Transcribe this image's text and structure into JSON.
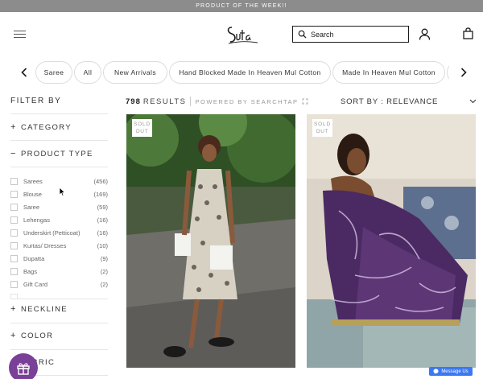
{
  "announcement": "PRODUCT OF THE WEEK!!",
  "header": {
    "logo_text": "Suta",
    "search_placeholder": "Search"
  },
  "categories": [
    "Saree",
    "All",
    "New Arrivals",
    "Hand Blocked Made In Heaven Mul Cotton",
    "Made In Heaven Mul Cotton"
  ],
  "sidebar": {
    "title": "FILTER BY",
    "facets": {
      "category": "CATEGORY",
      "product_type": "PRODUCT TYPE",
      "neckline": "NECKLINE",
      "color": "COLOR",
      "fabric": "FABRIC"
    },
    "product_types": [
      {
        "label": "Sarees",
        "count": "(456)"
      },
      {
        "label": "Blouse",
        "count": "(169)"
      },
      {
        "label": "Saree",
        "count": "(59)"
      },
      {
        "label": "Lehengas",
        "count": "(16)"
      },
      {
        "label": "Underskirt (Petticoat)",
        "count": "(16)"
      },
      {
        "label": "Kurtas/ Dresses",
        "count": "(10)"
      },
      {
        "label": "Dupatta",
        "count": "(9)"
      },
      {
        "label": "Bags",
        "count": "(2)"
      },
      {
        "label": "Gift Card",
        "count": "(2)"
      }
    ]
  },
  "results": {
    "count": "798",
    "label": "RESULTS",
    "powered_by": "POWERED BY SEARCHTAP",
    "sort_label": "SORT BY : RELEVANCE"
  },
  "products": [
    {
      "badge": "SOLD OUT"
    },
    {
      "badge": "SOLD OUT"
    }
  ],
  "messenger": "Message Us",
  "colors": {
    "announcement_bg": "#8c8c8c",
    "gift_button": "#7a3f96",
    "messenger_button": "#3b78f3"
  },
  "icons": [
    "menu-icon",
    "search-icon",
    "account-icon",
    "cart-icon",
    "chevron-left-icon",
    "chevron-right-icon",
    "chevron-down-icon",
    "gift-icon",
    "messenger-icon"
  ]
}
